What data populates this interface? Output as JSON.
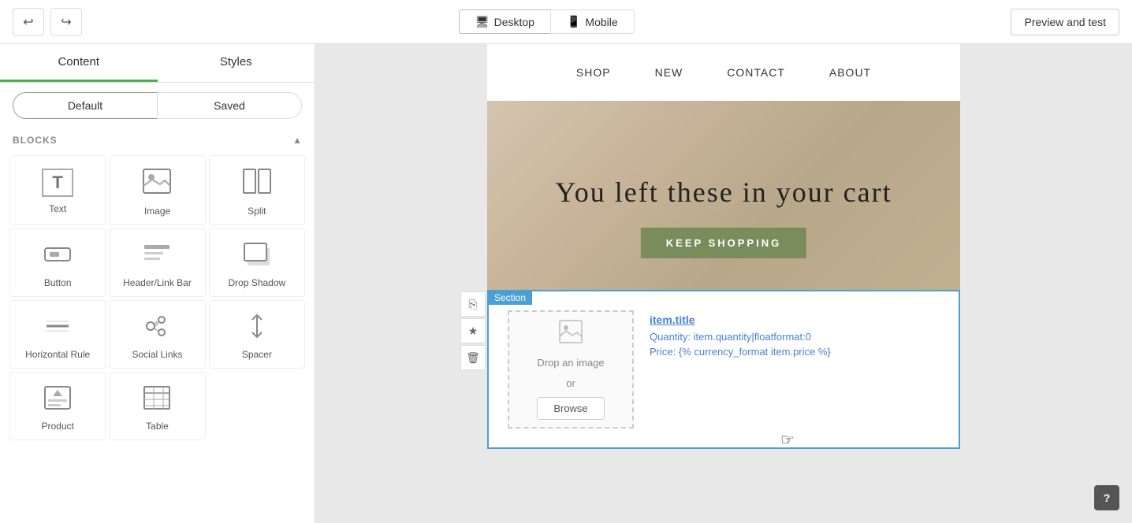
{
  "toolbar": {
    "undo_icon": "↩",
    "redo_icon": "↪",
    "desktop_label": "Desktop",
    "mobile_label": "Mobile",
    "preview_label": "Preview and test"
  },
  "sidebar": {
    "tab_content": "Content",
    "tab_styles": "Styles",
    "mode_default": "Default",
    "mode_saved": "Saved",
    "blocks_title": "BLOCKS",
    "blocks": [
      {
        "id": "text",
        "label": "Text",
        "icon": "T"
      },
      {
        "id": "image",
        "label": "Image",
        "icon": "🖼"
      },
      {
        "id": "split",
        "label": "Split",
        "icon": "⊞"
      },
      {
        "id": "button",
        "label": "Button",
        "icon": "▬"
      },
      {
        "id": "headerbar",
        "label": "Header/Link Bar",
        "icon": "≡"
      },
      {
        "id": "dropshadow",
        "label": "Drop Shadow",
        "icon": "▫"
      },
      {
        "id": "hrule",
        "label": "Horizontal Rule",
        "icon": "━"
      },
      {
        "id": "social",
        "label": "Social Links",
        "icon": "♥"
      },
      {
        "id": "spacer",
        "label": "Spacer",
        "icon": "↕"
      },
      {
        "id": "product",
        "label": "Product",
        "icon": "⬡"
      },
      {
        "id": "table",
        "label": "Table",
        "icon": "⊟"
      }
    ]
  },
  "preview": {
    "nav_items": [
      "SHOP",
      "NEW",
      "CONTACT",
      "ABOUT"
    ],
    "hero_text": "You left these in your cart",
    "hero_btn": "KEEP SHOPPING",
    "section_label": "Section",
    "upload_text_line1": "Drop an image",
    "upload_text_line2": "or",
    "browse_label": "Browse",
    "item_title": "item.title",
    "item_quantity_label": "Quantity:",
    "item_quantity_value": "item.quantity|floatformat:0",
    "item_price_label": "Price:",
    "item_price_value": "{% currency_format item.price %}"
  },
  "help_label": "?"
}
